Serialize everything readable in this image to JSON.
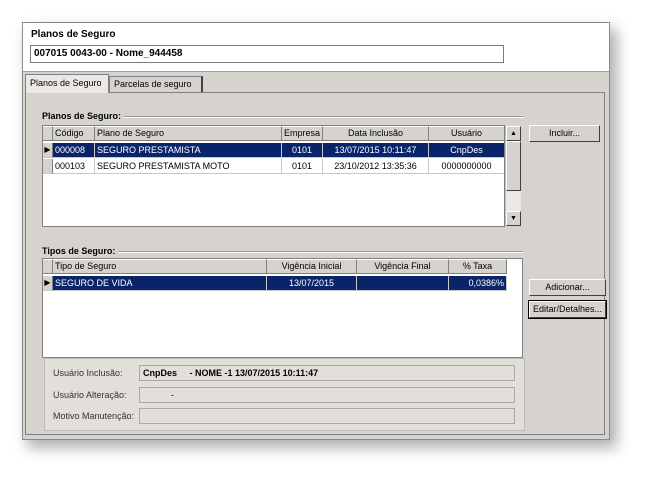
{
  "app": {
    "title": "Planos de Seguro",
    "record": "007015 0043-00 - Nome_944458"
  },
  "tabs": [
    {
      "label": "Planos de Seguro",
      "active": true
    },
    {
      "label": "Parcelas de seguro",
      "active": false
    }
  ],
  "planos": {
    "section_title": "Planos de Seguro:",
    "columns": [
      "Código",
      "Plano de Seguro",
      "Empresa",
      "Data Inclusão",
      "Usuário"
    ],
    "rows": [
      {
        "codigo": "000008",
        "plano": "SEGURO PRESTAMISTA",
        "empresa": "0101",
        "data": "13/07/2015 10:11:47",
        "usuario": "CnpDes",
        "selected": true
      },
      {
        "codigo": "000103",
        "plano": "SEGURO PRESTAMISTA MOTO",
        "empresa": "0101",
        "data": "23/10/2012 13:35:36",
        "usuario": "0000000000",
        "selected": false
      }
    ],
    "incluir_label": "Incluir..."
  },
  "tipos": {
    "section_title": "Tipos de Seguro:",
    "columns": [
      "Tipo de Seguro",
      "Vigência Inicial",
      "Vigência Final",
      "% Taxa"
    ],
    "rows": [
      {
        "tipo": "SEGURO DE VIDA",
        "inicio": "13/07/2015",
        "fim": "",
        "taxa": "0,0386%",
        "selected": true
      }
    ],
    "adicionar_label": "Adicionar...",
    "editar_label": "Editar/Detalhes..."
  },
  "footer": {
    "inclusao_label": "Usuário Inclusão:",
    "inclusao_user": "CnpDes",
    "inclusao_info": "- NOME -1  13/07/2015 10:11:47",
    "alteracao_label": "Usuário Alteração:",
    "alteracao_value": "-",
    "motivo_label": "Motivo Manutenção:",
    "motivo_value": ""
  },
  "icons": {
    "row_indicator": "black-right-pointer",
    "scroll_up": "up-arrow",
    "scroll_down": "down-arrow"
  }
}
